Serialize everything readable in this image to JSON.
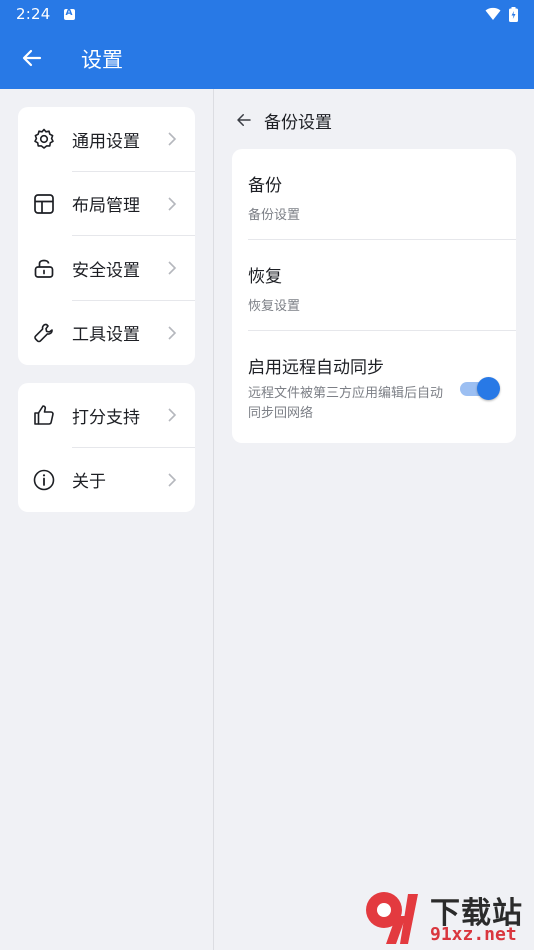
{
  "status": {
    "time": "2:24"
  },
  "appbar": {
    "title": "设置"
  },
  "menu": {
    "group1": [
      {
        "label": "通用设置",
        "icon": "gear-icon"
      },
      {
        "label": "布局管理",
        "icon": "layout-icon"
      },
      {
        "label": "安全设置",
        "icon": "lock-icon"
      },
      {
        "label": "工具设置",
        "icon": "wrench-icon"
      }
    ],
    "group2": [
      {
        "label": "打分支持",
        "icon": "thumbs-up-icon"
      },
      {
        "label": "关于",
        "icon": "info-icon"
      }
    ]
  },
  "detail": {
    "title": "备份设置",
    "items": [
      {
        "title": "备份",
        "subtitle": "备份设置"
      },
      {
        "title": "恢复",
        "subtitle": "恢复设置"
      },
      {
        "title": "启用远程自动同步",
        "subtitle": "远程文件被第三方应用编辑后自动同步回网络",
        "toggle_on": true
      }
    ]
  },
  "watermark": {
    "top": "下载站",
    "bottom": "91xz.net"
  },
  "colors": {
    "primary": "#2879e6",
    "background": "#f0f1f5",
    "card": "#ffffff"
  }
}
